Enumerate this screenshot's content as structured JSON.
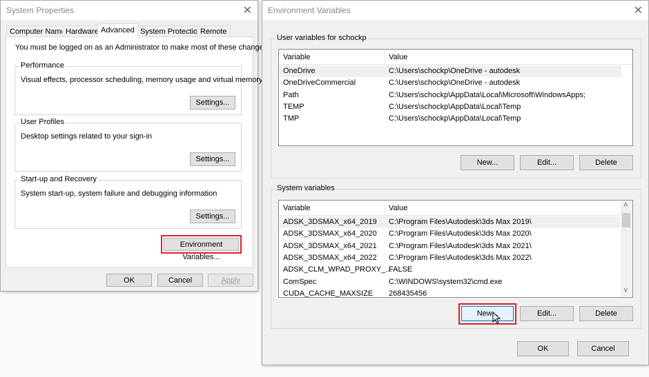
{
  "system_properties": {
    "title": "System Properties",
    "tabs": [
      "Computer Name",
      "Hardware",
      "Advanced",
      "System Protection",
      "Remote"
    ],
    "active_tab": "Advanced",
    "admin_notice": "You must be logged on as an Administrator to make most of these changes.",
    "groups": [
      {
        "label": "Performance",
        "desc": "Visual effects, processor scheduling, memory usage and virtual memory",
        "button": "Settings..."
      },
      {
        "label": "User Profiles",
        "desc": "Desktop settings related to your sign-in",
        "button": "Settings..."
      },
      {
        "label": "Start-up and Recovery",
        "desc": "System start-up, system failure and debugging information",
        "button": "Settings..."
      }
    ],
    "env_button": "Environment Variables...",
    "ok": "OK",
    "cancel": "Cancel",
    "apply": "Apply"
  },
  "env_vars": {
    "title": "Environment Variables",
    "user_group": "User variables for schockp",
    "col_variable": "Variable",
    "col_value": "Value",
    "user_rows": [
      {
        "name": "OneDrive",
        "value": "C:\\Users\\schockp\\OneDrive - autodesk"
      },
      {
        "name": "OneDriveCommercial",
        "value": "C:\\Users\\schockp\\OneDrive - autodesk"
      },
      {
        "name": "Path",
        "value": "C:\\Users\\schockp\\AppData\\Local\\Microsoft\\WindowsApps;"
      },
      {
        "name": "TEMP",
        "value": "C:\\Users\\schockp\\AppData\\Local\\Temp"
      },
      {
        "name": "TMP",
        "value": "C:\\Users\\schockp\\AppData\\Local\\Temp"
      }
    ],
    "system_group": "System variables",
    "system_rows": [
      {
        "name": "ADSK_3DSMAX_x64_2019",
        "value": "C:\\Program Files\\Autodesk\\3ds Max 2019\\"
      },
      {
        "name": "ADSK_3DSMAX_x64_2020",
        "value": "C:\\Program Files\\Autodesk\\3ds Max 2020\\"
      },
      {
        "name": "ADSK_3DSMAX_x64_2021",
        "value": "C:\\Program Files\\Autodesk\\3ds Max 2021\\"
      },
      {
        "name": "ADSK_3DSMAX_x64_2022",
        "value": "C:\\Program Files\\Autodesk\\3ds Max 2022\\"
      },
      {
        "name": "ADSK_CLM_WPAD_PROXY_...",
        "value": "FALSE"
      },
      {
        "name": "ComSpec",
        "value": "C:\\WINDOWS\\system32\\cmd.exe"
      },
      {
        "name": "CUDA_CACHE_MAXSIZE",
        "value": "268435456"
      }
    ],
    "new": "New...",
    "edit": "Edit...",
    "delete": "Delete",
    "ok": "OK",
    "cancel": "Cancel"
  },
  "icons": {
    "close": "✕",
    "scroll_up": "˄",
    "scroll_down": "˅"
  }
}
